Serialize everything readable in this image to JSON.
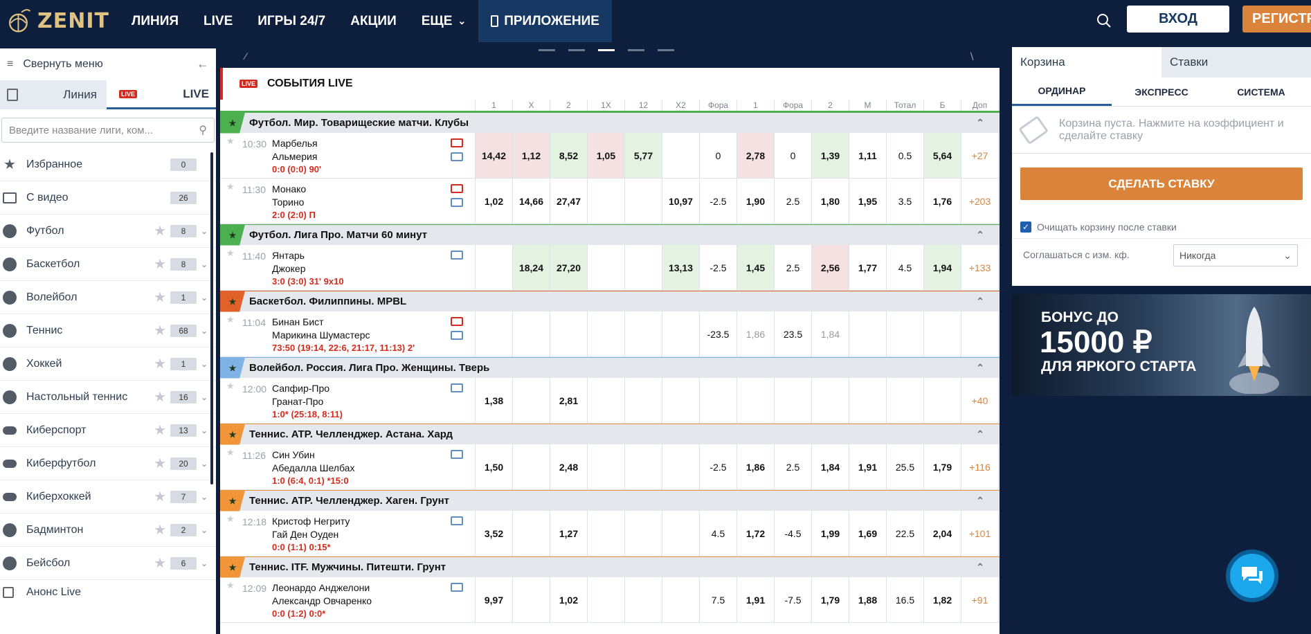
{
  "header": {
    "logo_text": "ZENIT",
    "nav": [
      {
        "label": "ЛИНИЯ"
      },
      {
        "label": "LIVE"
      },
      {
        "label": "ИГРЫ 24/7"
      },
      {
        "label": "АКЦИИ"
      },
      {
        "label": "ЕЩЕ"
      },
      {
        "label": "ПРИЛОЖЕНИЕ"
      }
    ],
    "login_label": "ВХОД",
    "register_label": "РЕГИСТРАЦИЯ"
  },
  "sidebar": {
    "collapse_label": "Свернуть меню",
    "tab_line": "Линия",
    "tab_live": "LIVE",
    "live_badge": "LIVE",
    "search_placeholder": "Введите название лиги, ком...",
    "items": [
      {
        "name": "Избранное",
        "count": "0",
        "icon": "star-icon"
      },
      {
        "name": "С видео",
        "count": "26",
        "icon": "video-icon"
      },
      {
        "name": "Футбол",
        "count": "8",
        "icon": "football-icon"
      },
      {
        "name": "Баскетбол",
        "count": "8",
        "icon": "basketball-icon"
      },
      {
        "name": "Волейбол",
        "count": "1",
        "icon": "volleyball-icon"
      },
      {
        "name": "Теннис",
        "count": "68",
        "icon": "tennis-icon"
      },
      {
        "name": "Хоккей",
        "count": "1",
        "icon": "hockey-icon"
      },
      {
        "name": "Настольный теннис",
        "count": "16",
        "icon": "table-tennis-icon"
      },
      {
        "name": "Киберспорт",
        "count": "13",
        "icon": "gamepad-icon"
      },
      {
        "name": "Киберфутбол",
        "count": "20",
        "icon": "gamepad-icon"
      },
      {
        "name": "Киберхоккей",
        "count": "7",
        "icon": "gamepad-icon"
      },
      {
        "name": "Бадминтон",
        "count": "2",
        "icon": "shuttlecock-icon"
      },
      {
        "name": "Бейсбол",
        "count": "6",
        "icon": "baseball-icon"
      }
    ],
    "anons_label": "Анонс Live"
  },
  "events": {
    "live_badge": "LIVE",
    "title": "СОБЫТИЯ LIVE",
    "columns": [
      "1",
      "X",
      "2",
      "1X",
      "12",
      "X2",
      "Фора",
      "1",
      "Фора",
      "2",
      "М",
      "Тотал",
      "Б",
      "Доп"
    ],
    "leagues": [
      {
        "name": "Футбол. Мир. Товарищеские матчи. Клубы",
        "tag_color": "#4caf50",
        "matches": [
          {
            "time": "10:30",
            "team1": "Марбелья",
            "team2": "Альмерия",
            "score": "0:0 (0:0) 90'",
            "video": true,
            "odds": [
              "14,42",
              "1,12",
              "8,52",
              "1,05",
              "5,77",
              "",
              "0",
              "2,78",
              "0",
              "1,39",
              "1,11",
              "0.5",
              "5,64",
              "+27"
            ],
            "bg": [
              "red",
              "red",
              "grn",
              "red",
              "grn",
              "",
              "",
              "red",
              "",
              "grn",
              "",
              "",
              "grn",
              ""
            ]
          },
          {
            "time": "11:30",
            "team1": "Монако",
            "team2": "Торино",
            "score": "2:0 (2:0) П",
            "video": true,
            "odds": [
              "1,02",
              "14,66",
              "27,47",
              "",
              "",
              "10,97",
              "-2.5",
              "1,90",
              "2.5",
              "1,80",
              "1,95",
              "3.5",
              "1,76",
              "+203"
            ],
            "bg": [
              "",
              "",
              "",
              "",
              "",
              "",
              "",
              "",
              "",
              "",
              "",
              "",
              "",
              ""
            ]
          }
        ]
      },
      {
        "name": "Футбол. Лига Про. Матчи 60 минут",
        "tag_color": "#4caf50",
        "matches": [
          {
            "time": "11:40",
            "team1": "Янтарь",
            "team2": "Джокер",
            "score": "3:0 (3:0) 31' 9x10",
            "video": false,
            "odds": [
              "",
              "18,24",
              "27,20",
              "",
              "",
              "13,13",
              "-2.5",
              "1,45",
              "2.5",
              "2,56",
              "1,77",
              "4.5",
              "1,94",
              "+133"
            ],
            "bg": [
              "",
              "grn",
              "grn",
              "",
              "",
              "grn",
              "",
              "grn",
              "",
              "red",
              "",
              "",
              "grn",
              ""
            ]
          }
        ]
      },
      {
        "name": "Баскетбол. Филиппины. MPBL",
        "tag_color": "#e0622a",
        "matches": [
          {
            "time": "11:04",
            "team1": "Бинан Бист",
            "team2": "Марикина Шумастерс",
            "score": "73:50 (19:14, 22:6, 21:17, 11:13) 2'",
            "video": true,
            "odds": [
              "",
              "",
              "",
              "",
              "",
              "",
              "-23.5",
              "1,86",
              "23.5",
              "1,84",
              "",
              "",
              "",
              ""
            ],
            "bg": [
              "",
              "",
              "",
              "",
              "",
              "",
              "",
              "dim",
              "",
              "dim",
              "",
              "",
              "",
              ""
            ]
          }
        ]
      },
      {
        "name": "Волейбол. Россия. Лига Про. Женщины. Тверь",
        "tag_color": "#7fb3e6",
        "matches": [
          {
            "time": "12:00",
            "team1": "Сапфир-Про",
            "team2": "Гранат-Про",
            "score": "1:0* (25:18, 8:11)",
            "video": false,
            "odds": [
              "1,38",
              "",
              "2,81",
              "",
              "",
              "",
              "",
              "",
              "",
              "",
              "",
              "",
              "",
              "+40"
            ],
            "bg": [
              "",
              "",
              "",
              "",
              "",
              "",
              "",
              "",
              "",
              "",
              "",
              "",
              "",
              ""
            ]
          }
        ]
      },
      {
        "name": "Теннис. ATP. Челленджер. Астана. Хард",
        "tag_color": "#f0953a",
        "matches": [
          {
            "time": "11:26",
            "team1": "Син Убин",
            "team2": "Абедалла Шелбах",
            "score": "1:0 (6:4, 0:1) *15:0",
            "video": false,
            "odds": [
              "1,50",
              "",
              "2,48",
              "",
              "",
              "",
              "-2.5",
              "1,86",
              "2.5",
              "1,84",
              "1,91",
              "25.5",
              "1,79",
              "+116"
            ],
            "bg": [
              "",
              "",
              "",
              "",
              "",
              "",
              "",
              "",
              "",
              "",
              "",
              "",
              "",
              ""
            ]
          }
        ]
      },
      {
        "name": "Теннис. ATP. Челленджер. Хаген. Грунт",
        "tag_color": "#f0953a",
        "matches": [
          {
            "time": "12:18",
            "team1": "Кристоф Негриту",
            "team2": "Гай Ден Оуден",
            "score": "0:0 (1:1) 0:15*",
            "video": false,
            "odds": [
              "3,52",
              "",
              "1,27",
              "",
              "",
              "",
              "4.5",
              "1,72",
              "-4.5",
              "1,99",
              "1,69",
              "22.5",
              "2,04",
              "+101"
            ],
            "bg": [
              "",
              "",
              "",
              "",
              "",
              "",
              "",
              "",
              "",
              "",
              "",
              "",
              "",
              ""
            ]
          }
        ]
      },
      {
        "name": "Теннис. ITF. Мужчины. Питешти. Грунт",
        "tag_color": "#f0953a",
        "matches": [
          {
            "time": "12:09",
            "team1": "Леонардо Анджелони",
            "team2": "Александр Овчаренко",
            "score": "0:0 (1:2) 0:0*",
            "video": false,
            "odds": [
              "9,97",
              "",
              "1,02",
              "",
              "",
              "",
              "7.5",
              "1,91",
              "-7.5",
              "1,79",
              "1,88",
              "16.5",
              "1,82",
              "+91"
            ],
            "bg": [
              "",
              "",
              "",
              "",
              "",
              "",
              "",
              "",
              "",
              "",
              "",
              "",
              "",
              ""
            ]
          }
        ]
      }
    ]
  },
  "coupon": {
    "tab_basket": "Корзина",
    "tab_bets": "Ставки",
    "sub_single": "ОРДИНАР",
    "sub_express": "ЭКСПРЕСС",
    "sub_system": "СИСТЕМА",
    "empty_text": "Корзина пуста. Нажмите на коэффициент и сделайте ставку",
    "make_bet": "СДЕЛАТЬ СТАВКУ",
    "clear_after": "Очищать корзину после ставки",
    "agree_label": "Соглашаться с изм. кф.",
    "agree_value": "Никогда"
  },
  "bonus": {
    "line1": "БОНУС ДО",
    "line2": "15000 ₽",
    "line3": "ДЛЯ ЯРКОГО СТАРТА"
  }
}
